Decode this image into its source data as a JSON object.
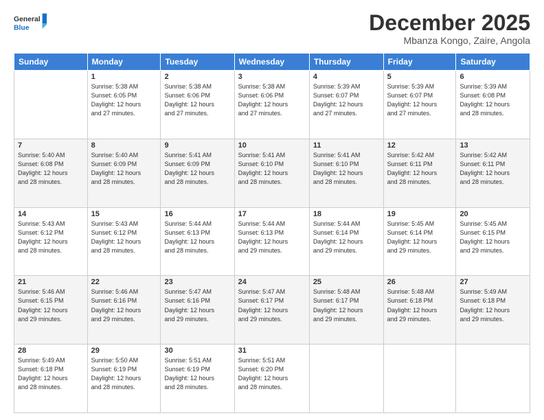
{
  "logo": {
    "general": "General",
    "blue": "Blue"
  },
  "header": {
    "month": "December 2025",
    "location": "Mbanza Kongo, Zaire, Angola"
  },
  "weekdays": [
    "Sunday",
    "Monday",
    "Tuesday",
    "Wednesday",
    "Thursday",
    "Friday",
    "Saturday"
  ],
  "weeks": [
    [
      {
        "day": "",
        "info": ""
      },
      {
        "day": "1",
        "info": "Sunrise: 5:38 AM\nSunset: 6:05 PM\nDaylight: 12 hours\nand 27 minutes."
      },
      {
        "day": "2",
        "info": "Sunrise: 5:38 AM\nSunset: 6:06 PM\nDaylight: 12 hours\nand 27 minutes."
      },
      {
        "day": "3",
        "info": "Sunrise: 5:38 AM\nSunset: 6:06 PM\nDaylight: 12 hours\nand 27 minutes."
      },
      {
        "day": "4",
        "info": "Sunrise: 5:39 AM\nSunset: 6:07 PM\nDaylight: 12 hours\nand 27 minutes."
      },
      {
        "day": "5",
        "info": "Sunrise: 5:39 AM\nSunset: 6:07 PM\nDaylight: 12 hours\nand 27 minutes."
      },
      {
        "day": "6",
        "info": "Sunrise: 5:39 AM\nSunset: 6:08 PM\nDaylight: 12 hours\nand 28 minutes."
      }
    ],
    [
      {
        "day": "7",
        "info": "Sunrise: 5:40 AM\nSunset: 6:08 PM\nDaylight: 12 hours\nand 28 minutes."
      },
      {
        "day": "8",
        "info": "Sunrise: 5:40 AM\nSunset: 6:09 PM\nDaylight: 12 hours\nand 28 minutes."
      },
      {
        "day": "9",
        "info": "Sunrise: 5:41 AM\nSunset: 6:09 PM\nDaylight: 12 hours\nand 28 minutes."
      },
      {
        "day": "10",
        "info": "Sunrise: 5:41 AM\nSunset: 6:10 PM\nDaylight: 12 hours\nand 28 minutes."
      },
      {
        "day": "11",
        "info": "Sunrise: 5:41 AM\nSunset: 6:10 PM\nDaylight: 12 hours\nand 28 minutes."
      },
      {
        "day": "12",
        "info": "Sunrise: 5:42 AM\nSunset: 6:11 PM\nDaylight: 12 hours\nand 28 minutes."
      },
      {
        "day": "13",
        "info": "Sunrise: 5:42 AM\nSunset: 6:11 PM\nDaylight: 12 hours\nand 28 minutes."
      }
    ],
    [
      {
        "day": "14",
        "info": "Sunrise: 5:43 AM\nSunset: 6:12 PM\nDaylight: 12 hours\nand 28 minutes."
      },
      {
        "day": "15",
        "info": "Sunrise: 5:43 AM\nSunset: 6:12 PM\nDaylight: 12 hours\nand 28 minutes."
      },
      {
        "day": "16",
        "info": "Sunrise: 5:44 AM\nSunset: 6:13 PM\nDaylight: 12 hours\nand 28 minutes."
      },
      {
        "day": "17",
        "info": "Sunrise: 5:44 AM\nSunset: 6:13 PM\nDaylight: 12 hours\nand 29 minutes."
      },
      {
        "day": "18",
        "info": "Sunrise: 5:44 AM\nSunset: 6:14 PM\nDaylight: 12 hours\nand 29 minutes."
      },
      {
        "day": "19",
        "info": "Sunrise: 5:45 AM\nSunset: 6:14 PM\nDaylight: 12 hours\nand 29 minutes."
      },
      {
        "day": "20",
        "info": "Sunrise: 5:45 AM\nSunset: 6:15 PM\nDaylight: 12 hours\nand 29 minutes."
      }
    ],
    [
      {
        "day": "21",
        "info": "Sunrise: 5:46 AM\nSunset: 6:15 PM\nDaylight: 12 hours\nand 29 minutes."
      },
      {
        "day": "22",
        "info": "Sunrise: 5:46 AM\nSunset: 6:16 PM\nDaylight: 12 hours\nand 29 minutes."
      },
      {
        "day": "23",
        "info": "Sunrise: 5:47 AM\nSunset: 6:16 PM\nDaylight: 12 hours\nand 29 minutes."
      },
      {
        "day": "24",
        "info": "Sunrise: 5:47 AM\nSunset: 6:17 PM\nDaylight: 12 hours\nand 29 minutes."
      },
      {
        "day": "25",
        "info": "Sunrise: 5:48 AM\nSunset: 6:17 PM\nDaylight: 12 hours\nand 29 minutes."
      },
      {
        "day": "26",
        "info": "Sunrise: 5:48 AM\nSunset: 6:18 PM\nDaylight: 12 hours\nand 29 minutes."
      },
      {
        "day": "27",
        "info": "Sunrise: 5:49 AM\nSunset: 6:18 PM\nDaylight: 12 hours\nand 29 minutes."
      }
    ],
    [
      {
        "day": "28",
        "info": "Sunrise: 5:49 AM\nSunset: 6:18 PM\nDaylight: 12 hours\nand 28 minutes."
      },
      {
        "day": "29",
        "info": "Sunrise: 5:50 AM\nSunset: 6:19 PM\nDaylight: 12 hours\nand 28 minutes."
      },
      {
        "day": "30",
        "info": "Sunrise: 5:51 AM\nSunset: 6:19 PM\nDaylight: 12 hours\nand 28 minutes."
      },
      {
        "day": "31",
        "info": "Sunrise: 5:51 AM\nSunset: 6:20 PM\nDaylight: 12 hours\nand 28 minutes."
      },
      {
        "day": "",
        "info": ""
      },
      {
        "day": "",
        "info": ""
      },
      {
        "day": "",
        "info": ""
      }
    ]
  ]
}
